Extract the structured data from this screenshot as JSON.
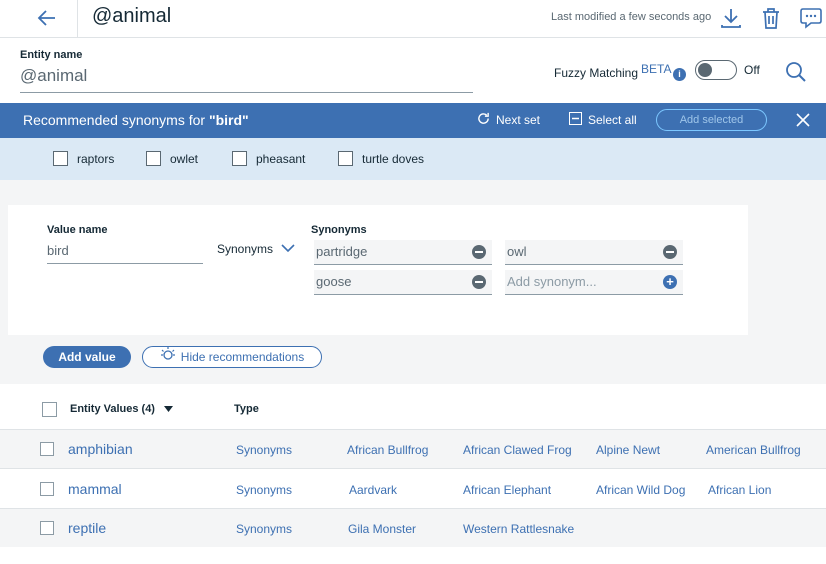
{
  "header": {
    "title": "@animal",
    "last_modified": "Last modified a few seconds ago"
  },
  "entity": {
    "label": "Entity name",
    "value": "@animal",
    "fuzzy_label": "Fuzzy Matching",
    "beta": "BETA",
    "info": "i",
    "toggle_state": "Off"
  },
  "recommendations": {
    "prefix": "Recommended synonyms for ",
    "term": "\"bird\"",
    "next_set": "Next set",
    "select_all": "Select all",
    "add_selected": "Add selected",
    "items": [
      "raptors",
      "owlet",
      "pheasant",
      "turtle doves"
    ]
  },
  "editor": {
    "value_name_label": "Value name",
    "value_name": "bird",
    "type_select": "Synonyms",
    "synonyms_label": "Synonyms",
    "synonyms": [
      "partridge",
      "owl",
      "goose"
    ],
    "add_synonym_placeholder": "Add synonym...",
    "add_value": "Add value",
    "hide_recommendations": "Hide recommendations"
  },
  "table": {
    "header_values": "Entity Values (4)",
    "header_type": "Type",
    "rows": [
      {
        "name": "amphibian",
        "type": "Synonyms",
        "values": [
          "African Bullfrog",
          "African Clawed Frog",
          "Alpine Newt",
          "American Bullfrog"
        ]
      },
      {
        "name": "mammal",
        "type": "Synonyms",
        "values": [
          "Aardvark",
          "African Elephant",
          "African Wild Dog",
          "African Lion"
        ]
      },
      {
        "name": "reptile",
        "type": "Synonyms",
        "values": [
          "Gila Monster",
          "Western Rattlesnake"
        ]
      }
    ]
  },
  "colors": {
    "accent": "#3d70b2",
    "reco_bg": "#dbe9f5",
    "text": "#152935"
  }
}
